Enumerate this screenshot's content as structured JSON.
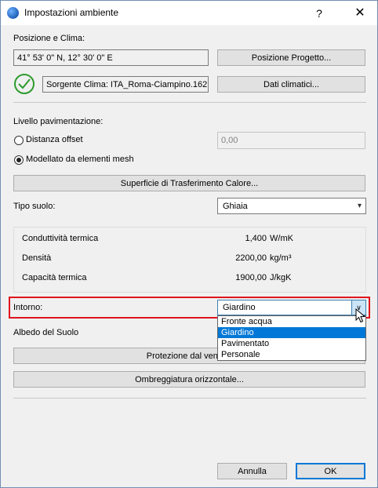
{
  "window": {
    "title": "Impostazioni ambiente",
    "help": "?",
    "close": "✕"
  },
  "posizione": {
    "section_label": "Posizione e Clima:",
    "coords": "41° 53' 0\" N, 12° 30' 0\" E",
    "posizione_btn": "Posizione Progetto...",
    "sorgente": "Sorgente Clima: ITA_Roma-Ciampino.162",
    "dati_btn": "Dati climatici..."
  },
  "pavimentazione": {
    "section_label": "Livello pavimentazione:",
    "offset_label": "Distanza offset",
    "offset_value": "0,00",
    "mesh_label": "Modellato da elementi mesh",
    "superficie_btn": "Superficie di Trasferimento Calore..."
  },
  "suolo": {
    "label": "Tipo suolo:",
    "value": "Ghiaia",
    "props": [
      {
        "name": "Conduttività termica",
        "value": "1,400",
        "unit": "W/mK"
      },
      {
        "name": "Densità",
        "value": "2200,00",
        "unit": "kg/m³"
      },
      {
        "name": "Capacità termica",
        "value": "1900,00",
        "unit": "J/kgK"
      }
    ]
  },
  "intorno": {
    "label": "Intorno:",
    "value": "Giardino",
    "options": [
      "Fronte acqua",
      "Giardino",
      "Pavimentato",
      "Personale"
    ],
    "selected_index": 1
  },
  "albedo_label": "Albedo del Suolo",
  "protezione_btn": "Protezione dal vento...",
  "ombreggiatura_btn": "Ombreggiatura orizzontale...",
  "footer": {
    "cancel": "Annulla",
    "ok": "OK"
  },
  "colors": {
    "highlight": "#e0141e",
    "selection": "#0078d7",
    "ok_check": "#2e9b2e"
  }
}
